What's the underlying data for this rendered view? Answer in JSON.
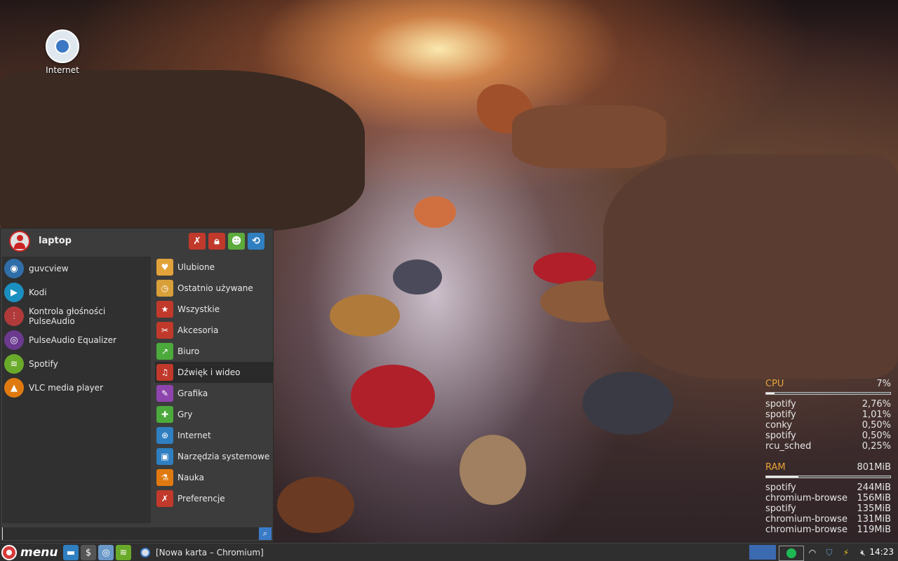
{
  "desktop": {
    "icons": [
      {
        "label": "Internet",
        "icon": "chromium-icon"
      }
    ]
  },
  "menu": {
    "username": "laptop",
    "header_buttons": [
      {
        "icon": "tools-icon",
        "color": "#c0392b"
      },
      {
        "icon": "lock-icon",
        "color": "#c0392b"
      },
      {
        "icon": "users-icon",
        "color": "#5cab3c"
      },
      {
        "icon": "logout-icon",
        "color": "#2f7fc1"
      }
    ],
    "favorites": [
      {
        "label": "guvcview",
        "icon": "webcam-icon",
        "color": "#2f6ea8"
      },
      {
        "label": "Kodi",
        "icon": "kodi-icon",
        "color": "#1b8fc0"
      },
      {
        "label": "Kontrola głośności PulseAudio",
        "icon": "mixer-icon",
        "color": "#b03a3a"
      },
      {
        "label": "PulseAudio Equalizer",
        "icon": "equalizer-icon",
        "color": "#6b3a8f"
      },
      {
        "label": "Spotify",
        "icon": "spotify-icon",
        "color": "#6aaa2a"
      },
      {
        "label": "VLC media player",
        "icon": "vlc-icon",
        "color": "#e07a10"
      }
    ],
    "categories": [
      {
        "label": "Ulubione",
        "icon": "heart-icon",
        "color": "#e2a23a"
      },
      {
        "label": "Ostatnio używane",
        "icon": "clock-icon",
        "color": "#d9a03a"
      },
      {
        "label": "Wszystkie",
        "icon": "shapes-icon",
        "color": "#c0392b"
      },
      {
        "label": "Akcesoria",
        "icon": "accessories-icon",
        "color": "#c0392b"
      },
      {
        "label": "Biuro",
        "icon": "chart-icon",
        "color": "#4caa3c"
      },
      {
        "label": "Dźwięk i wideo",
        "icon": "music-icon",
        "color": "#c0392b"
      },
      {
        "label": "Grafika",
        "icon": "palette-icon",
        "color": "#8e44ad"
      },
      {
        "label": "Gry",
        "icon": "gamepad-icon",
        "color": "#4caa3c"
      },
      {
        "label": "Internet",
        "icon": "globe-icon",
        "color": "#2f7fc1"
      },
      {
        "label": "Narzędzia systemowe",
        "icon": "system-icon",
        "color": "#2f7fc1"
      },
      {
        "label": "Nauka",
        "icon": "flask-icon",
        "color": "#e07a10"
      },
      {
        "label": "Preferencje",
        "icon": "preferences-icon",
        "color": "#c0392b"
      }
    ],
    "active_category": "Dźwięk i wideo",
    "search": {
      "value": "",
      "placeholder": ""
    }
  },
  "conky": {
    "cpu": {
      "label": "CPU",
      "value": "7%",
      "fraction": 0.07,
      "processes": [
        {
          "name": "spotify",
          "value": "2,76%"
        },
        {
          "name": "spotify",
          "value": "1,01%"
        },
        {
          "name": "conky",
          "value": "0,50%"
        },
        {
          "name": "spotify",
          "value": "0,50%"
        },
        {
          "name": "rcu_sched",
          "value": "0,25%"
        }
      ]
    },
    "ram": {
      "label": "RAM",
      "value": "801MiB",
      "fraction": 0.26,
      "processes": [
        {
          "name": "spotify",
          "value": "244MiB"
        },
        {
          "name": "chromium-browse",
          "value": "156MiB"
        },
        {
          "name": "spotify",
          "value": "135MiB"
        },
        {
          "name": "chromium-browse",
          "value": "131MiB"
        },
        {
          "name": "chromium-browse",
          "value": "119MiB"
        }
      ]
    }
  },
  "panel": {
    "menu_label": "menu",
    "launchers": [
      {
        "icon": "file-manager-icon",
        "color": "#2f7fc1",
        "glyph": "▬"
      },
      {
        "icon": "terminal-icon",
        "color": "#555555",
        "glyph": "$"
      },
      {
        "icon": "chromium-icon",
        "color": "#6a98c8",
        "glyph": "◎"
      },
      {
        "icon": "spotify-icon",
        "color": "#6aaa2a",
        "glyph": "≋"
      }
    ],
    "task": "[Nowa karta – Chromium]",
    "clock": "14:23"
  }
}
